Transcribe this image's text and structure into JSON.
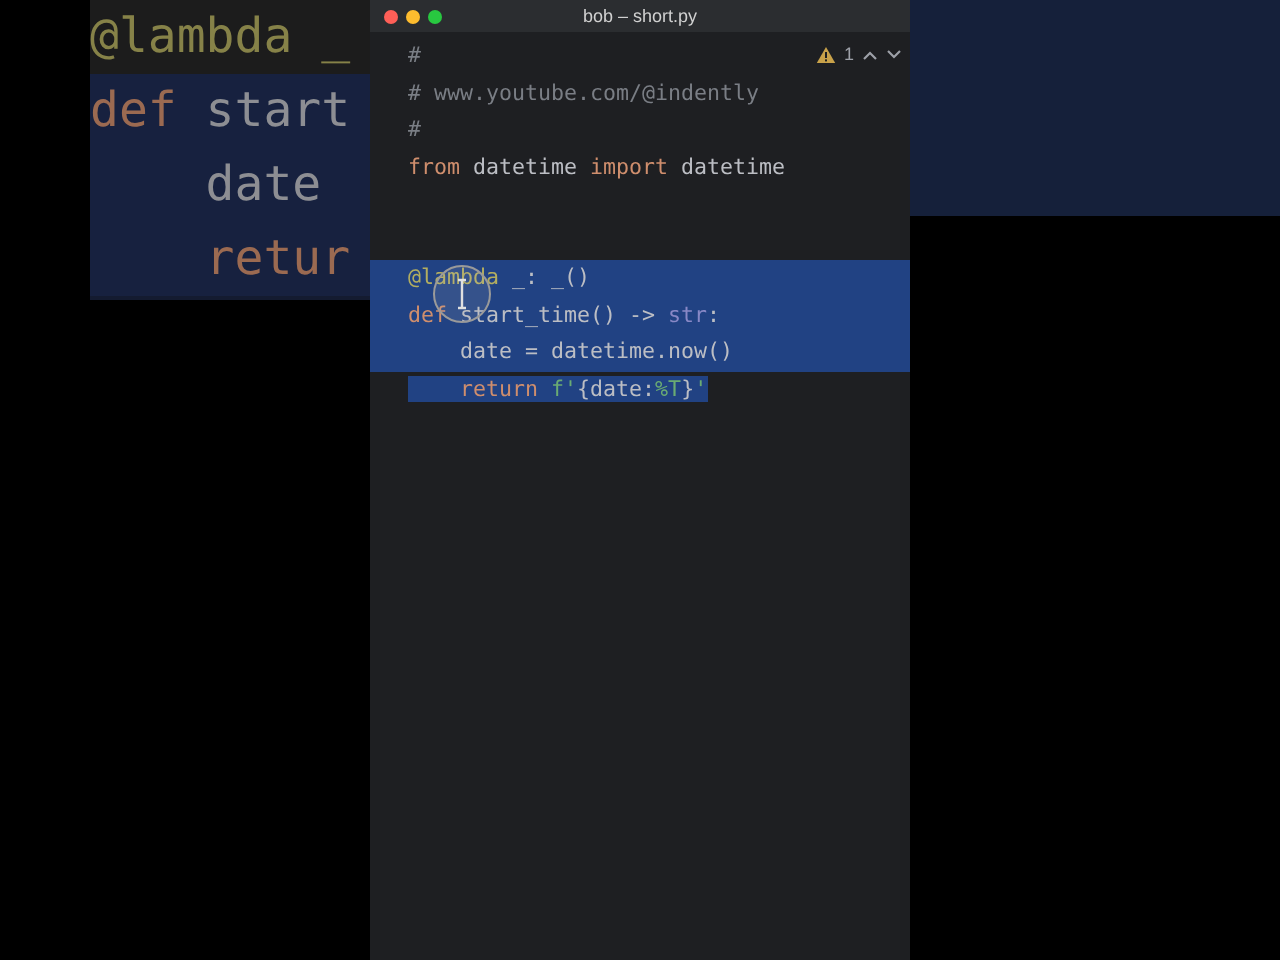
{
  "background_zoom": {
    "lines": [
      {
        "tokens": [
          {
            "kind": "decorator",
            "text": "@lambda _"
          }
        ],
        "selected": false
      },
      {
        "tokens": [
          {
            "kind": "keyword",
            "text": "def"
          },
          {
            "kind": "plain",
            "text": " start"
          }
        ],
        "selected": true
      },
      {
        "tokens": [
          {
            "kind": "plain",
            "text": "    date"
          }
        ],
        "selected": true
      },
      {
        "tokens": [
          {
            "kind": "keyword",
            "text": "    retur"
          }
        ],
        "selected": true
      }
    ]
  },
  "window": {
    "title": "bob – short.py"
  },
  "inspection": {
    "count": "1"
  },
  "editor": {
    "lines": [
      {
        "tokens": [
          {
            "kind": "comment",
            "text": "#"
          }
        ],
        "selected": false
      },
      {
        "tokens": [
          {
            "kind": "comment",
            "text": "# www.youtube.com/@indently"
          }
        ],
        "selected": false
      },
      {
        "tokens": [
          {
            "kind": "comment",
            "text": "#"
          }
        ],
        "selected": false
      },
      {
        "tokens": [
          {
            "kind": "keyword",
            "text": "from"
          },
          {
            "kind": "plain",
            "text": " datetime "
          },
          {
            "kind": "keyword",
            "text": "import"
          },
          {
            "kind": "plain",
            "text": " datetime"
          }
        ],
        "selected": false
      },
      {
        "kind": "blank"
      },
      {
        "kind": "blank"
      },
      {
        "tokens": [
          {
            "kind": "decorator",
            "text": "@lambda"
          },
          {
            "kind": "plain",
            "text": " _: _()"
          }
        ],
        "selected": true
      },
      {
        "tokens": [
          {
            "kind": "keyword",
            "text": "def"
          },
          {
            "kind": "plain",
            "text": " start_time() -> "
          },
          {
            "kind": "type",
            "text": "str"
          },
          {
            "kind": "plain",
            "text": ":"
          }
        ],
        "selected": true
      },
      {
        "tokens": [
          {
            "kind": "plain",
            "text": "    date = datetime.now()"
          }
        ],
        "selected": true
      },
      {
        "tokens": [
          {
            "kind": "keyword",
            "text": "    return "
          },
          {
            "kind": "string",
            "text": "f'"
          },
          {
            "kind": "plain",
            "text": "{date:"
          },
          {
            "kind": "string",
            "text": "%T"
          },
          {
            "kind": "plain",
            "text": "}"
          },
          {
            "kind": "string",
            "text": "'"
          }
        ],
        "selected": true
      }
    ]
  }
}
